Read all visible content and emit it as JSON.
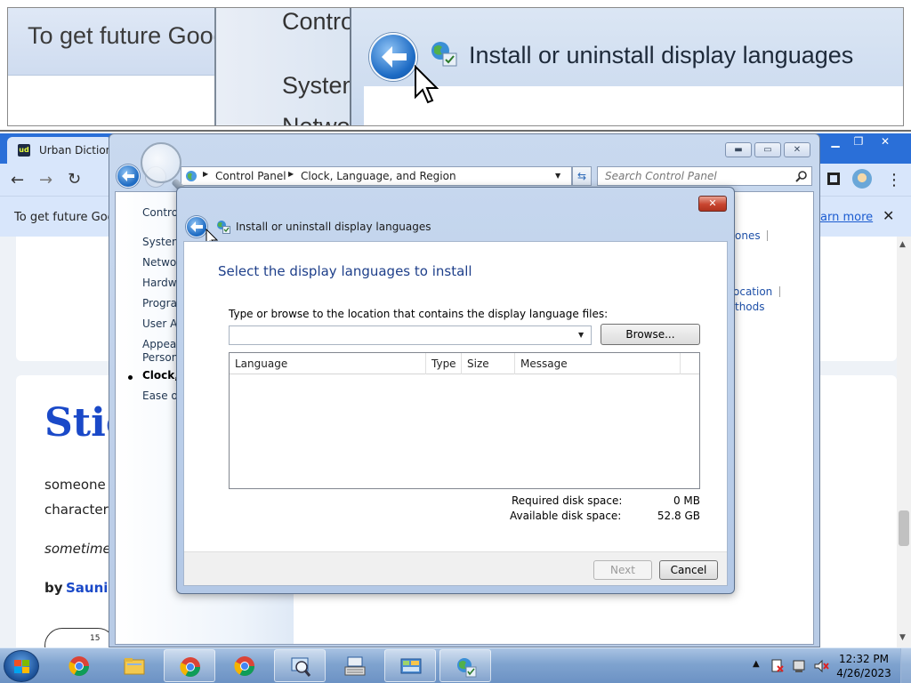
{
  "magnifier": {
    "left_text": "To get future Goog",
    "mid_control": "Control",
    "mid_system": "System",
    "mid_network": "Netwo",
    "title": "Install or uninstall display languages"
  },
  "browser": {
    "tab_title": "Urban Dictiona",
    "tab_favicon": "ud",
    "info_text": "To get future Goog",
    "info_link": "earn more",
    "word_title": "Stic",
    "def_line1": "someone",
    "def_line2": "character",
    "example": "sometime",
    "author_by": "by",
    "author_name": "Sauni",
    "vote_count": "15"
  },
  "control_panel": {
    "address": {
      "crumb1": "Control Panel",
      "crumb2": "Clock, Language, and Region"
    },
    "search_placeholder": "Search Control Panel",
    "nav": {
      "control": "Control",
      "system": "System",
      "network": "Networ",
      "hardware": "Hardwa",
      "programs": "Progra",
      "user_accounts": "User Ac",
      "appearance_1": "Appear",
      "appearance_2": "Persona",
      "clock": "Clock, l",
      "ease": "Ease of"
    },
    "right_links": {
      "zones": "ones",
      "location": "ocation",
      "methods": "thods"
    }
  },
  "dialog": {
    "title": "Install or uninstall display languages",
    "heading": "Select the display languages to install",
    "prompt": "Type or browse to the location that contains the display language files:",
    "path_value": "",
    "browse_label": "Browse...",
    "columns": [
      "Language",
      "Type",
      "Size",
      "Message"
    ],
    "required_label": "Required disk space:",
    "required_value": "0 MB",
    "available_label": "Available disk space:",
    "available_value": "52.8 GB",
    "next_label": "Next",
    "cancel_label": "Cancel",
    "close_label": "✕"
  },
  "taskbar": {
    "time": "12:32 PM",
    "date": "4/26/2023"
  }
}
